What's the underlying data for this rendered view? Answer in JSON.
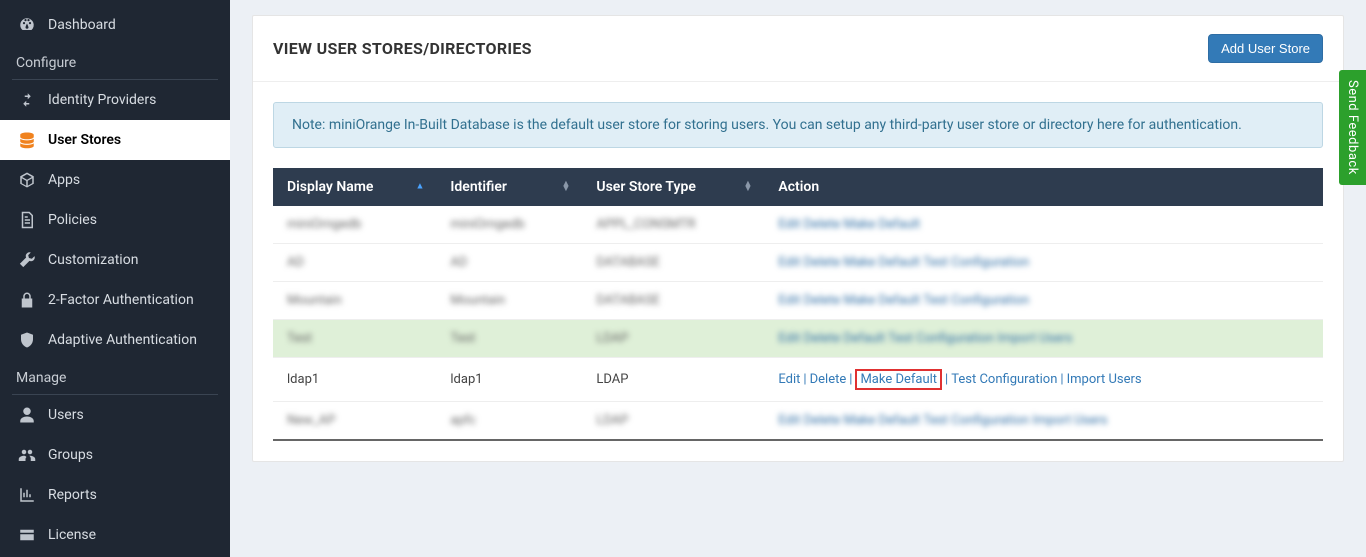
{
  "sidebar": {
    "items": [
      {
        "label": "Dashboard",
        "icon": "gauge-icon"
      }
    ],
    "section_configure": "Configure",
    "configure_items": [
      {
        "label": "Identity Providers",
        "icon": "swap-icon"
      },
      {
        "label": "User Stores",
        "icon": "stack-icon"
      },
      {
        "label": "Apps",
        "icon": "cube-icon"
      },
      {
        "label": "Policies",
        "icon": "doc-icon"
      },
      {
        "label": "Customization",
        "icon": "wrench-icon"
      },
      {
        "label": "2-Factor Authentication",
        "icon": "lock-icon"
      },
      {
        "label": "Adaptive Authentication",
        "icon": "shield-icon"
      }
    ],
    "section_manage": "Manage",
    "manage_items": [
      {
        "label": "Users",
        "icon": "user-icon"
      },
      {
        "label": "Groups",
        "icon": "users-icon"
      },
      {
        "label": "Reports",
        "icon": "chart-icon"
      },
      {
        "label": "License",
        "icon": "card-icon"
      }
    ]
  },
  "page": {
    "title": "VIEW USER STORES/DIRECTORIES",
    "add_button": "Add User Store",
    "note": "Note: miniOrange In-Built Database is the default user store for storing users. You can setup any third-party user store or directory here for authentication."
  },
  "table": {
    "headers": {
      "display": "Display Name",
      "identifier": "Identifier",
      "type": "User Store Type",
      "action": "Action"
    },
    "row_clear": {
      "display": "ldap1",
      "identifier": "ldap1",
      "type": "LDAP",
      "actions": {
        "edit": "Edit",
        "delete": "Delete",
        "make_default": "Make Default",
        "test": "Test Configuration",
        "import": "Import Users"
      }
    }
  },
  "feedback": "Send Feedback"
}
